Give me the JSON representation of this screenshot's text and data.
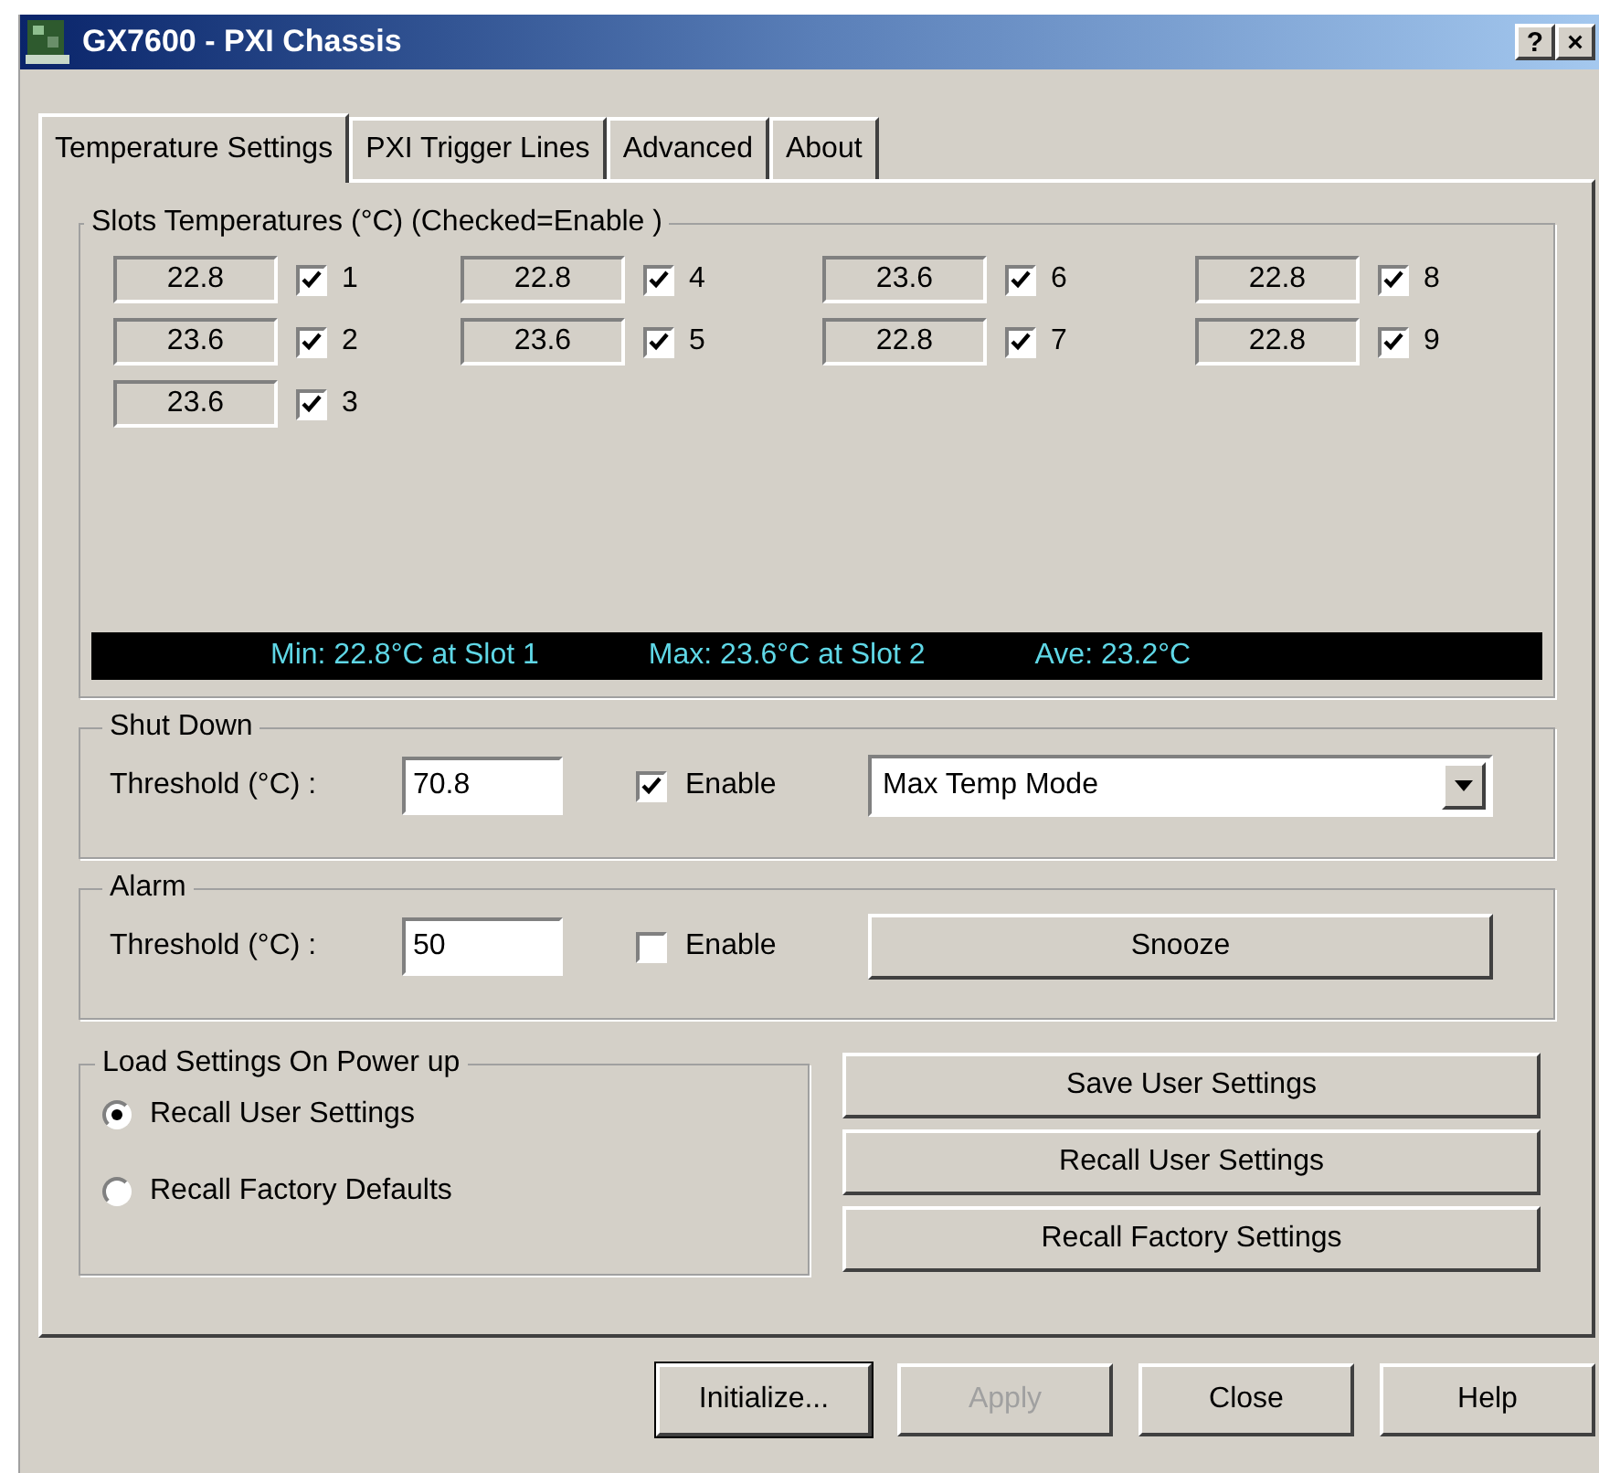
{
  "window": {
    "title": "GX7600 - PXI Chassis",
    "title_buttons": [
      "?",
      "×"
    ]
  },
  "tabs": [
    {
      "label": "Temperature Settings",
      "selected": true
    },
    {
      "label": "PXI Trigger Lines",
      "selected": false
    },
    {
      "label": "Advanced",
      "selected": false
    },
    {
      "label": "About",
      "selected": false
    }
  ],
  "slots_group": {
    "title": "Slots Temperatures (°C)  (Checked=Enable )",
    "columns": [
      [
        {
          "value": "22.8",
          "checked": true,
          "slot": "1"
        },
        {
          "value": "23.6",
          "checked": true,
          "slot": "2"
        },
        {
          "value": "23.6",
          "checked": true,
          "slot": "3"
        }
      ],
      [
        {
          "value": "22.8",
          "checked": true,
          "slot": "4"
        },
        {
          "value": "23.6",
          "checked": true,
          "slot": "5"
        }
      ],
      [
        {
          "value": "23.6",
          "checked": true,
          "slot": "6"
        },
        {
          "value": "22.8",
          "checked": true,
          "slot": "7"
        }
      ],
      [
        {
          "value": "22.8",
          "checked": true,
          "slot": "8"
        },
        {
          "value": "22.8",
          "checked": true,
          "slot": "9"
        }
      ]
    ],
    "summary": [
      "Min: 22.8°C at Slot 1",
      "Max: 23.6°C at Slot 2",
      "Ave: 23.2°C"
    ]
  },
  "shut_down": {
    "title": "Shut Down",
    "threshold_label": "Threshold (°C) :",
    "threshold": "70.8",
    "enable": {
      "label": "Enable",
      "checked": true
    },
    "mode": "Max Temp Mode"
  },
  "alarm": {
    "title": "Alarm",
    "threshold_label": "Threshold (°C) :",
    "threshold": "50",
    "enable": {
      "label": "Enable",
      "checked": false
    },
    "button": "Snooze"
  },
  "load_settings": {
    "title": "Load Settings On Power up",
    "options": [
      {
        "label": "Recall User Settings",
        "selected": true
      },
      {
        "label": "Recall Factory Defaults",
        "selected": false
      }
    ]
  },
  "settings_buttons": [
    "Save User Settings",
    "Recall User Settings",
    "Recall Factory Settings"
  ],
  "footer_buttons": [
    {
      "label": "Initialize...",
      "disabled": false,
      "default": true
    },
    {
      "label": "Apply",
      "disabled": true,
      "default": false
    },
    {
      "label": "Close",
      "disabled": false,
      "default": false
    },
    {
      "label": "Help",
      "disabled": false,
      "default": false
    }
  ]
}
